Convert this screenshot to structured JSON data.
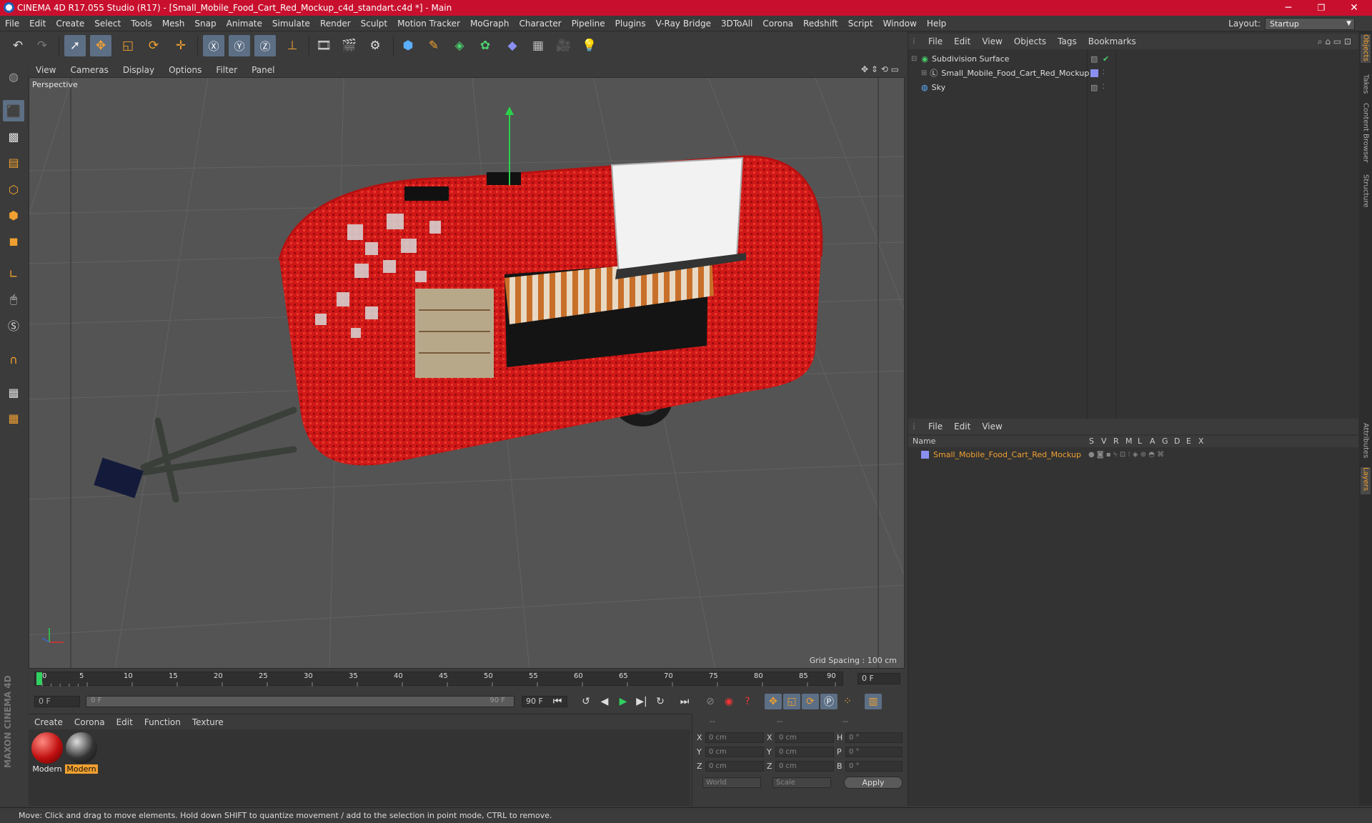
{
  "titlebar": {
    "title": "CINEMA 4D R17.055 Studio (R17) - [Small_Mobile_Food_Cart_Red_Mockup_c4d_standart.c4d *] - Main",
    "minimize": "─",
    "restore": "❐",
    "close": "✕"
  },
  "menubar": {
    "items": [
      "File",
      "Edit",
      "Create",
      "Select",
      "Tools",
      "Mesh",
      "Snap",
      "Animate",
      "Simulate",
      "Render",
      "Sculpt",
      "Motion Tracker",
      "MoGraph",
      "Character",
      "Pipeline",
      "Plugins",
      "V-Ray Bridge",
      "3DToAll",
      "Corona",
      "Redshift",
      "Script",
      "Window",
      "Help"
    ],
    "layout_label": "Layout:",
    "layout_value": "Startup"
  },
  "viewport": {
    "menu": [
      "View",
      "Cameras",
      "Display",
      "Options",
      "Filter",
      "Panel"
    ],
    "label": "Perspective",
    "grid_spacing": "Grid Spacing : 100 cm"
  },
  "timeline": {
    "ticks": [
      "0",
      "5",
      "10",
      "15",
      "20",
      "25",
      "30",
      "35",
      "40",
      "45",
      "50",
      "55",
      "60",
      "65",
      "70",
      "75",
      "80",
      "85",
      "90"
    ],
    "current_frame": "0 F"
  },
  "transport": {
    "start_field": "0 F",
    "slider_left": "0 F",
    "slider_right": "90 F",
    "end_field": "90 F"
  },
  "materials": {
    "menu": [
      "Create",
      "Corona",
      "Edit",
      "Function",
      "Texture"
    ],
    "items": [
      {
        "name": "Modern",
        "selected": false
      },
      {
        "name": "Modern",
        "selected": true
      }
    ]
  },
  "coords": {
    "headers": [
      "--",
      "--",
      "--"
    ],
    "rows": [
      {
        "a": "X",
        "av": "0 cm",
        "b": "X",
        "bv": "0 cm",
        "c": "H",
        "cv": "0 °"
      },
      {
        "a": "Y",
        "av": "0 cm",
        "b": "Y",
        "bv": "0 cm",
        "c": "P",
        "cv": "0 °"
      },
      {
        "a": "Z",
        "av": "0 cm",
        "b": "Z",
        "bv": "0 cm",
        "c": "B",
        "cv": "0 °"
      }
    ],
    "world": "World",
    "scale": "Scale",
    "apply": "Apply"
  },
  "objects": {
    "menu": [
      "File",
      "Edit",
      "View",
      "Objects",
      "Tags",
      "Bookmarks"
    ],
    "items": [
      {
        "name": "Subdivision Surface"
      },
      {
        "name": "Small_Mobile_Food_Cart_Red_Mockup"
      },
      {
        "name": "Sky"
      }
    ]
  },
  "layers": {
    "menu": [
      "File",
      "Edit",
      "View"
    ],
    "col_name": "Name",
    "cols": [
      "S",
      "V",
      "R",
      "M",
      "L",
      "A",
      "G",
      "D",
      "E",
      "X"
    ],
    "row": "Small_Mobile_Food_Cart_Red_Mockup"
  },
  "sidetabs": {
    "top": [
      "Objects",
      "Takes",
      "Content Browser",
      "Structure"
    ],
    "bottom": [
      "Attributes",
      "Layers"
    ]
  },
  "brand": "MAXON CINEMA 4D",
  "status": "Move: Click and drag to move elements. Hold down SHIFT to quantize movement / add to the selection in point mode, CTRL to remove.",
  "colors": {
    "accent": "#c8102e",
    "selection": "#f0a030",
    "highlight": "#5d6f85"
  }
}
